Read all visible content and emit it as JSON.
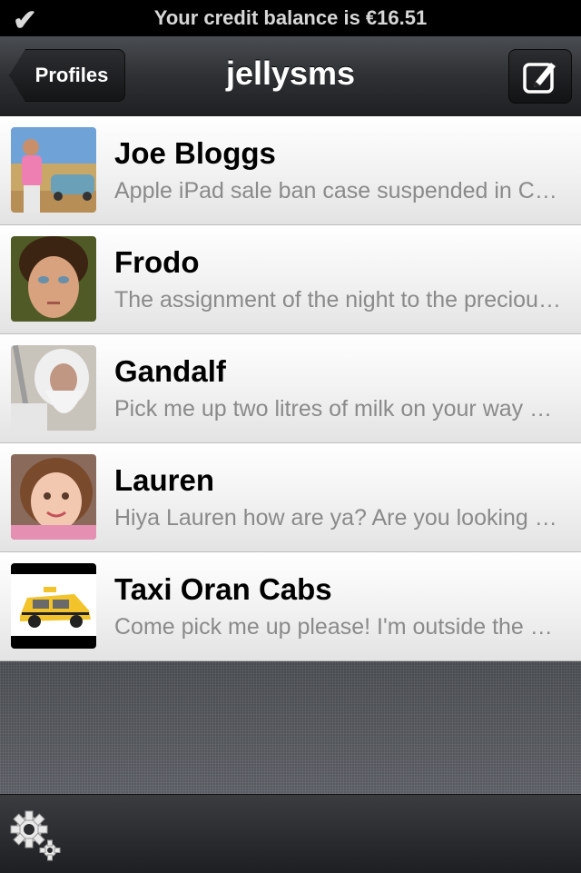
{
  "status_bar": {
    "check_icon": "checkmark-icon",
    "credit_text": "Your credit balance is €16.51"
  },
  "nav": {
    "back_label": "Profiles",
    "title": "jellysms",
    "compose_icon": "compose-icon"
  },
  "conversations": [
    {
      "name": "Joe Bloggs",
      "preview": "Apple iPad sale ban case suspended in China",
      "avatar": "joe-bloggs-avatar"
    },
    {
      "name": "Frodo",
      "preview": "The assignment of the night to the precious ring",
      "avatar": "frodo-avatar"
    },
    {
      "name": "Gandalf",
      "preview": "Pick me up two litres of milk on your way home",
      "avatar": "gandalf-avatar"
    },
    {
      "name": "Lauren",
      "preview": "Hiya Lauren how are ya? Are you looking forward",
      "avatar": "lauren-avatar"
    },
    {
      "name": "Taxi Oran Cabs",
      "preview": "Come pick me up please! I'm outside the shop",
      "avatar": "taxi-avatar"
    }
  ],
  "toolbar": {
    "settings_icon": "settings-gear-icon"
  },
  "colors": {
    "navbar": "#2e3033",
    "row_bg": "#f1f1f1",
    "preview_text": "#8a8a8a"
  }
}
